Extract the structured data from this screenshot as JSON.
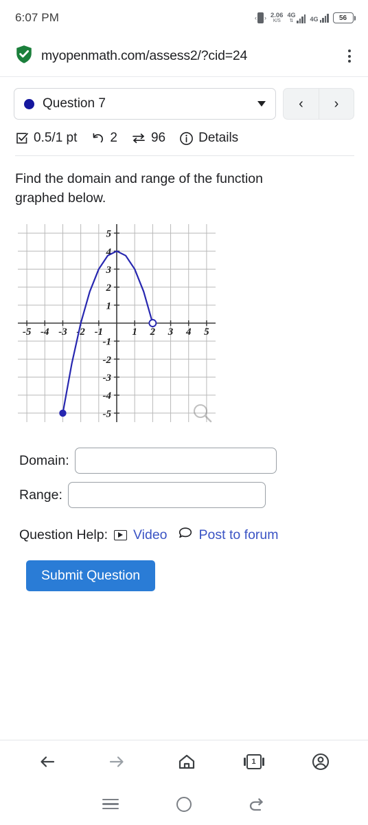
{
  "status_bar": {
    "time": "6:07 PM",
    "vibrate_icon": "vibrate-icon",
    "net_speed_value": "2.06",
    "net_speed_unit": "K/S",
    "sim1_network": "4G",
    "sim1_arrows": "⇅",
    "sim2_network": "4G",
    "battery_level": "56"
  },
  "browser": {
    "security_icon": "shield-check-icon",
    "url": "myopenmath.com/assess2/?cid=24",
    "menu_icon": "kebab-menu-icon"
  },
  "question_header": {
    "status_dot_color": "#15179e",
    "question_label": "Question 7",
    "dropdown_icon": "chevron-down-icon",
    "prev_label": "‹",
    "next_label": "›"
  },
  "meta": {
    "score_icon": "checkbox-checked-icon",
    "score": "0.5/1 pt",
    "attempts_icon": "undo-arrow-icon",
    "attempts": "2",
    "views_icon": "swap-arrows-icon",
    "views": "96",
    "info_icon": "info-circle-icon",
    "details_label": "Details"
  },
  "prompt": {
    "text": "Find the domain and range of the function graphed below."
  },
  "chart_data": {
    "type": "line",
    "title": "",
    "xlabel": "",
    "ylabel": "",
    "xlim": [
      -5.5,
      5.5
    ],
    "ylim": [
      -5.5,
      5.5
    ],
    "grid": true,
    "x_ticks": [
      -5,
      -4,
      -3,
      -2,
      -1,
      1,
      2,
      3,
      4,
      5
    ],
    "y_ticks": [
      5,
      4,
      3,
      2,
      1,
      -1,
      -2,
      -3,
      -4,
      -5
    ],
    "curve_color": "#2727b0",
    "function": "y = 4 - x^2",
    "domain_drawn": [
      -3,
      2
    ],
    "points": [
      {
        "x": -3,
        "y": -5
      },
      {
        "x": -2.5,
        "y": -2.25
      },
      {
        "x": -2,
        "y": 0
      },
      {
        "x": -1.5,
        "y": 1.75
      },
      {
        "x": -1,
        "y": 3
      },
      {
        "x": -0.5,
        "y": 3.75
      },
      {
        "x": 0,
        "y": 4
      },
      {
        "x": 0.5,
        "y": 3.75
      },
      {
        "x": 1,
        "y": 3
      },
      {
        "x": 1.5,
        "y": 1.75
      },
      {
        "x": 2,
        "y": 0
      }
    ],
    "endpoints": [
      {
        "x": -3,
        "y": -5,
        "style": "closed"
      },
      {
        "x": 2,
        "y": 0,
        "style": "open"
      }
    ],
    "magnifier_icon": "magnifier-icon"
  },
  "answers": {
    "domain_label": "Domain:",
    "domain_value": "",
    "range_label": "Range:",
    "range_value": ""
  },
  "help": {
    "label": "Question Help:",
    "video_icon": "video-play-icon",
    "video_label": "Video",
    "forum_icon": "speech-bubble-icon",
    "forum_label": "Post to forum",
    "link_color": "#3a53c4"
  },
  "submit": {
    "label": "Submit Question",
    "color": "#2a7cd6"
  },
  "browser_bar": {
    "back_icon": "back-arrow-icon",
    "forward_icon": "forward-arrow-icon",
    "home_icon": "home-icon",
    "tabs_icon": "tabs-icon",
    "tab_count": "1",
    "profile_icon": "account-circle-icon"
  },
  "android_nav": {
    "recents_icon": "recents-menu-icon",
    "home_icon": "home-circle-icon",
    "back_icon": "back-curved-arrow-icon"
  }
}
